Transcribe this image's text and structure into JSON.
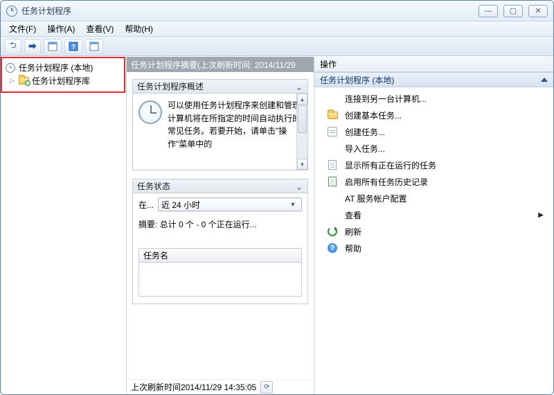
{
  "window": {
    "title": "任务计划程序"
  },
  "menu": {
    "file": "文件(F)",
    "action": "操作(A)",
    "view": "查看(V)",
    "help": "帮助(H)"
  },
  "tree": {
    "root": "任务计划程序 (本地)",
    "lib": "任务计划程序库"
  },
  "mid": {
    "header": "任务计划程序摘要(上次刷新时间: 2014/11/29",
    "overview": {
      "title": "任务计划程序概述",
      "text": "可以使用任务计划程序来创建和管理计算机将在所指定的时间自动执行的常见任务。若要开始，请单击\"操作\"菜单中的"
    },
    "status": {
      "title": "任务状态",
      "in_label": "在...",
      "dropdown": "近 24 小时",
      "summary": "摘要: 总计 0 个 - 0 个正在运行...",
      "col_name": "任务名"
    },
    "footer": "上次刷新时间2014/11/29 14:35:05"
  },
  "actions": {
    "panel_title": "操作",
    "group": "任务计划程序 (本地)",
    "items": {
      "connect": "连接到另一台计算机...",
      "create_basic": "创建基本任务...",
      "create_task": "创建任务...",
      "import_task": "导入任务...",
      "show_running": "显示所有正在运行的任务",
      "enable_history": "启用所有任务历史记录",
      "at_service": "AT 服务帐户配置",
      "view": "查看",
      "refresh": "刷新",
      "help": "帮助"
    }
  }
}
